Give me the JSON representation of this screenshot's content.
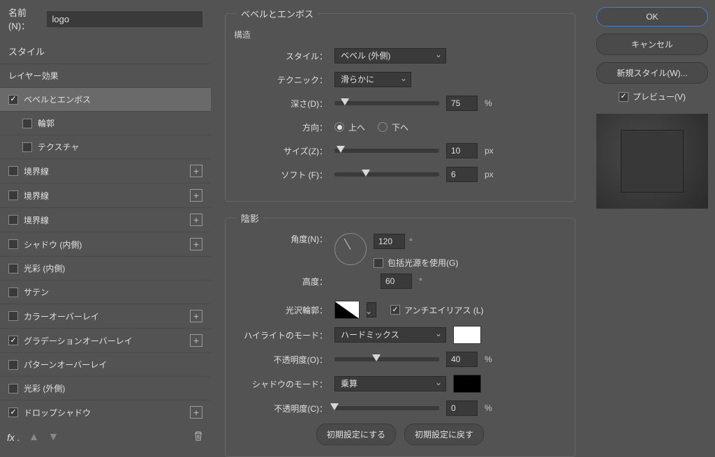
{
  "nameLabel": "名前(N)：",
  "nameValue": "logo",
  "styleHeader": "スタイル",
  "styleItems": [
    {
      "label": "レイヤー効果",
      "hasCheckbox": false,
      "checked": false,
      "selected": false,
      "add": false,
      "sub": false
    },
    {
      "label": "ベベルとエンボス",
      "hasCheckbox": true,
      "checked": true,
      "selected": true,
      "add": false,
      "sub": false
    },
    {
      "label": "輪郭",
      "hasCheckbox": true,
      "checked": false,
      "selected": false,
      "add": false,
      "sub": true
    },
    {
      "label": "テクスチャ",
      "hasCheckbox": true,
      "checked": false,
      "selected": false,
      "add": false,
      "sub": true
    },
    {
      "label": "境界線",
      "hasCheckbox": true,
      "checked": false,
      "selected": false,
      "add": true,
      "sub": false
    },
    {
      "label": "境界線",
      "hasCheckbox": true,
      "checked": false,
      "selected": false,
      "add": true,
      "sub": false
    },
    {
      "label": "境界線",
      "hasCheckbox": true,
      "checked": false,
      "selected": false,
      "add": true,
      "sub": false
    },
    {
      "label": "シャドウ (内側)",
      "hasCheckbox": true,
      "checked": false,
      "selected": false,
      "add": true,
      "sub": false
    },
    {
      "label": "光彩 (内側)",
      "hasCheckbox": true,
      "checked": false,
      "selected": false,
      "add": false,
      "sub": false
    },
    {
      "label": "サテン",
      "hasCheckbox": true,
      "checked": false,
      "selected": false,
      "add": false,
      "sub": false
    },
    {
      "label": "カラーオーバーレイ",
      "hasCheckbox": true,
      "checked": false,
      "selected": false,
      "add": true,
      "sub": false
    },
    {
      "label": "グラデーションオーバーレイ",
      "hasCheckbox": true,
      "checked": true,
      "selected": false,
      "add": true,
      "sub": false
    },
    {
      "label": "パターンオーバーレイ",
      "hasCheckbox": true,
      "checked": false,
      "selected": false,
      "add": false,
      "sub": false
    },
    {
      "label": "光彩 (外側)",
      "hasCheckbox": true,
      "checked": false,
      "selected": false,
      "add": false,
      "sub": false
    },
    {
      "label": "ドロップシャドウ",
      "hasCheckbox": true,
      "checked": true,
      "selected": false,
      "add": true,
      "sub": false
    }
  ],
  "fxLabel": "fx",
  "groupTitle": "ベベルとエンボス",
  "structureTitle": "構造",
  "styleLabel": "スタイル：",
  "styleValue": "ベベル (外側)",
  "techniqueLabel": "テクニック：",
  "techniqueValue": "滑らかに",
  "depthLabel": "深さ(D)：",
  "depthValue": "75",
  "depthUnit": "%",
  "directionLabel": "方向：",
  "directionUp": "上へ",
  "directionDown": "下へ",
  "sizeLabel": "サイズ(Z)：",
  "sizeValue": "10",
  "sizeUnit": "px",
  "softLabel": "ソフト (F)：",
  "softValue": "6",
  "softUnit": "px",
  "shadingTitle": "陰影",
  "angleLabel": "角度(N)：",
  "angleValue": "120",
  "angleUnit": "°",
  "globalLightLabel": "包括光源を使用(G)",
  "altitudeLabel": "高度：",
  "altitudeValue": "60",
  "altitudeUnit": "°",
  "glossContourLabel": "光沢輪郭：",
  "antiAliasLabel": "アンチエイリアス (L)",
  "highlightModeLabel": "ハイライトのモード：",
  "highlightModeValue": "ハードミックス",
  "highlightColor": "#ffffff",
  "highlightOpacityLabel": "不透明度(O)：",
  "highlightOpacityValue": "40",
  "highlightOpacityUnit": "%",
  "shadowModeLabel": "シャドウのモード：",
  "shadowModeValue": "乗算",
  "shadowColor": "#000000",
  "shadowOpacityLabel": "不透明度(C)：",
  "shadowOpacityValue": "0",
  "shadowOpacityUnit": "%",
  "makeDefaultLabel": "初期設定にする",
  "resetDefaultLabel": "初期設定に戻す",
  "okLabel": "OK",
  "cancelLabel": "キャンセル",
  "newStyleLabel": "新規スタイル(W)...",
  "previewLabel": "プレビュー(V)"
}
